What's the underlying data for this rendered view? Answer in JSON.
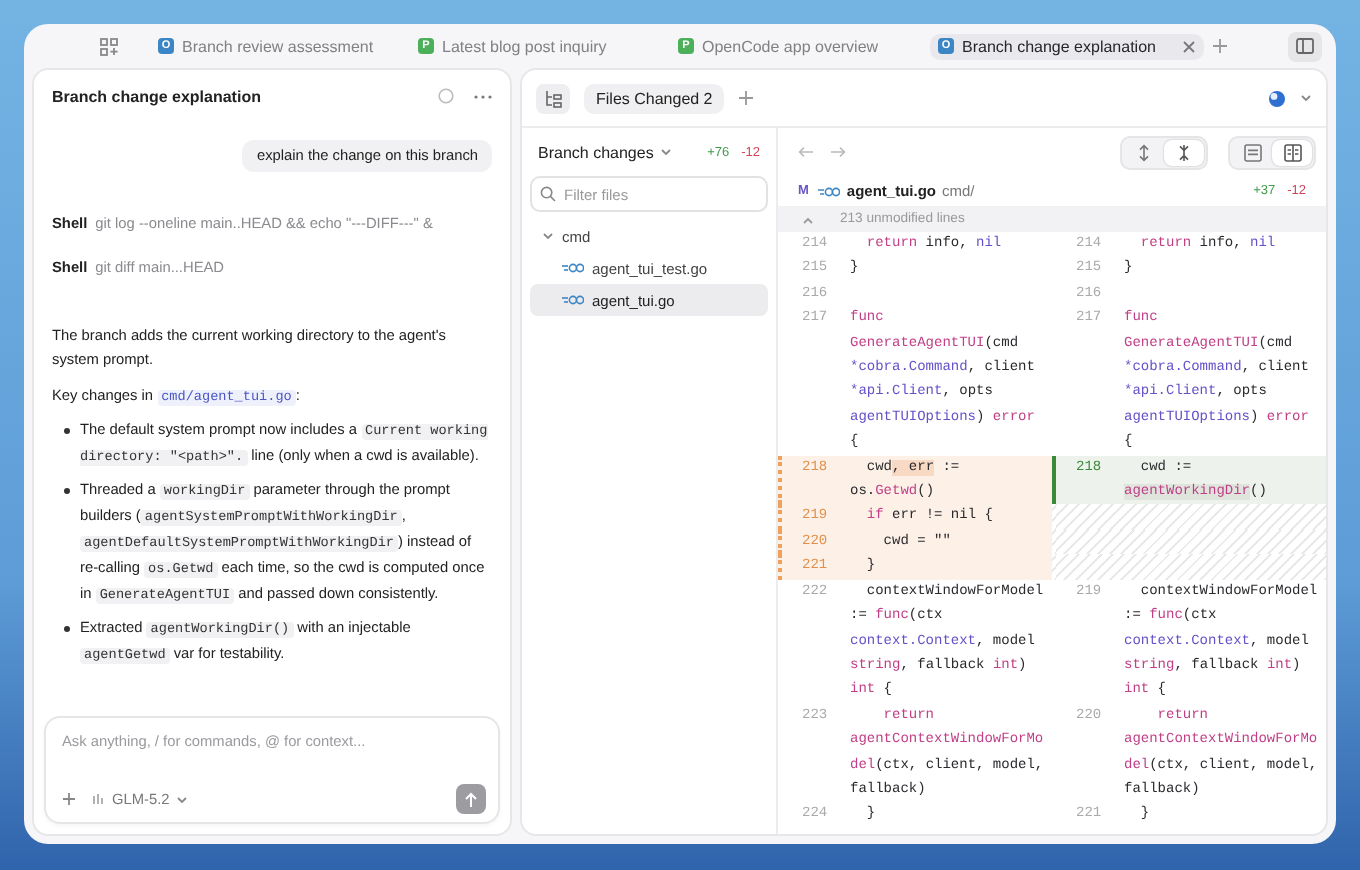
{
  "tabs": [
    {
      "badge": "O",
      "color": "#3d86c6",
      "label": "Branch review assessment",
      "selected": false
    },
    {
      "badge": "P",
      "color": "#4caf5a",
      "label": "Latest blog post inquiry",
      "selected": false
    },
    {
      "badge": "P",
      "color": "#4caf5a",
      "label": "OpenCode app overview",
      "selected": false
    },
    {
      "badge": "O",
      "color": "#3d86c6",
      "label": "Branch change explanation",
      "selected": true
    }
  ],
  "chat": {
    "title": "Branch change explanation",
    "messages": [
      {
        "kind": "user",
        "text": "explain the change on this branch"
      },
      {
        "kind": "shell",
        "label": "Shell",
        "command": "git log --oneline main..HEAD && echo \"---DIFF---\" &"
      },
      {
        "kind": "shell",
        "label": "Shell",
        "command": "git diff main...HEAD"
      },
      {
        "kind": "paragraph",
        "parts": [
          {
            "kind": "text",
            "text": "The branch adds the current working directory to the agent's system prompt."
          }
        ]
      },
      {
        "kind": "paragraph",
        "parts": [
          {
            "kind": "text",
            "text": "Key changes in "
          },
          {
            "kind": "link",
            "text": "cmd/agent_tui.go"
          },
          {
            "kind": "text",
            "text": ":"
          }
        ]
      },
      {
        "kind": "bullets",
        "items": [
          [
            {
              "kind": "text",
              "text": "The default system prompt now includes a "
            },
            {
              "kind": "code",
              "text": "Current working directory: \"<path>\"."
            },
            {
              "kind": "text",
              "text": " line (only when a cwd is available)."
            }
          ],
          [
            {
              "kind": "text",
              "text": "Threaded a "
            },
            {
              "kind": "code",
              "text": "workingDir"
            },
            {
              "kind": "text",
              "text": " parameter through the prompt builders ("
            },
            {
              "kind": "code",
              "text": "agentSystemPromptWithWorkingDir"
            },
            {
              "kind": "text",
              "text": ", "
            },
            {
              "kind": "code",
              "text": "agentDefaultSystemPromptWithWorkingDir"
            },
            {
              "kind": "text",
              "text": ") instead of re-calling "
            },
            {
              "kind": "code",
              "text": "os.Getwd"
            },
            {
              "kind": "text",
              "text": " each time, so the cwd is computed once in "
            },
            {
              "kind": "code",
              "text": "GenerateAgentTUI"
            },
            {
              "kind": "text",
              "text": " and passed down consistently."
            }
          ],
          [
            {
              "kind": "text",
              "text": "Extracted "
            },
            {
              "kind": "code",
              "text": "agentWorkingDir()"
            },
            {
              "kind": "text",
              "text": " with an injectable "
            },
            {
              "kind": "code",
              "text": "agentGetwd"
            },
            {
              "kind": "text",
              "text": " var for testability."
            }
          ]
        ]
      }
    ],
    "composer": {
      "placeholder": "Ask anything, / for commands, @ for context...",
      "model": "GLM-5.2"
    }
  },
  "workspace_tabs": [
    {
      "label": "Files Changed 2",
      "selected": true
    }
  ],
  "changes": {
    "title": "Branch changes",
    "added": "+76",
    "removed": "-12",
    "filter_placeholder": "Filter files",
    "tree": [
      {
        "name": "cmd",
        "expanded": true,
        "selected": false,
        "children": [
          {
            "name": "agent_tui_test.go",
            "selected": false
          },
          {
            "name": "agent_tui.go",
            "selected": true
          }
        ]
      }
    ]
  },
  "diff": {
    "view_controls": [
      {
        "kind": "expand",
        "selected": false
      },
      {
        "kind": "collapse",
        "selected": true
      }
    ],
    "layout_controls": [
      {
        "kind": "unified",
        "selected": false
      },
      {
        "kind": "split",
        "selected": true
      }
    ],
    "file": {
      "status": "M",
      "name": "agent_tui.go",
      "dir": "cmd/",
      "added": "+37",
      "removed": "-12"
    },
    "collapsed": "213 unmodified lines",
    "rows": [
      {
        "left": {
          "kind": "context",
          "num": "214",
          "lines": [
            [
              {
                "kind": "kw",
                "text": "  return"
              },
              {
                "kind": "plain",
                "text": " info, "
              },
              {
                "kind": "type",
                "text": "nil"
              }
            ]
          ]
        },
        "right": {
          "kind": "context",
          "num": "214",
          "lines": [
            [
              {
                "kind": "kw",
                "text": "  return"
              },
              {
                "kind": "plain",
                "text": " info, "
              },
              {
                "kind": "type",
                "text": "nil"
              }
            ]
          ]
        }
      },
      {
        "left": {
          "kind": "context",
          "num": "215",
          "lines": [
            [
              {
                "kind": "plain",
                "text": "}"
              }
            ]
          ]
        },
        "right": {
          "kind": "context",
          "num": "215",
          "lines": [
            [
              {
                "kind": "plain",
                "text": "}"
              }
            ]
          ]
        }
      },
      {
        "left": {
          "kind": "context",
          "num": "216"
        },
        "right": {
          "kind": "context",
          "num": "216"
        }
      },
      {
        "left": {
          "kind": "context",
          "num": "217",
          "lines": [
            [
              {
                "kind": "kw",
                "text": "func"
              }
            ],
            [
              {
                "kind": "fn",
                "text": "GenerateAgentTUI"
              },
              {
                "kind": "plain",
                "text": "(cmd"
              }
            ],
            [
              {
                "kind": "type",
                "text": "*cobra.Command"
              },
              {
                "kind": "plain",
                "text": ", client"
              }
            ],
            [
              {
                "kind": "type",
                "text": "*api.Client"
              },
              {
                "kind": "plain",
                "text": ", opts"
              }
            ],
            [
              {
                "kind": "type",
                "text": "agentTUIOptions"
              },
              {
                "kind": "plain",
                "text": ") "
              },
              {
                "kind": "kw",
                "text": "error"
              }
            ],
            [
              {
                "kind": "plain",
                "text": "{"
              }
            ]
          ]
        },
        "right": {
          "kind": "context",
          "num": "217",
          "lines": [
            [
              {
                "kind": "kw",
                "text": "func"
              }
            ],
            [
              {
                "kind": "fn",
                "text": "GenerateAgentTUI"
              },
              {
                "kind": "plain",
                "text": "(cmd"
              }
            ],
            [
              {
                "kind": "type",
                "text": "*cobra.Command"
              },
              {
                "kind": "plain",
                "text": ", client"
              }
            ],
            [
              {
                "kind": "type",
                "text": "*api.Client"
              },
              {
                "kind": "plain",
                "text": ", opts"
              }
            ],
            [
              {
                "kind": "type",
                "text": "agentTUIOptions"
              },
              {
                "kind": "plain",
                "text": ") "
              },
              {
                "kind": "kw",
                "text": "error"
              }
            ],
            [
              {
                "kind": "plain",
                "text": "{"
              }
            ]
          ]
        }
      },
      {
        "left": {
          "kind": "deleted",
          "num": "218",
          "lines": [
            [
              {
                "kind": "plain",
                "text": "  cwd"
              },
              {
                "kind": "changed",
                "text": ", err"
              },
              {
                "kind": "plain",
                "text": " :="
              }
            ],
            [
              {
                "kind": "plain",
                "text": "os."
              },
              {
                "kind": "fn",
                "text": "Getwd"
              },
              {
                "kind": "plain",
                "text": "()"
              }
            ]
          ]
        },
        "right": {
          "kind": "added",
          "num": "218",
          "lines": [
            [
              {
                "kind": "plain",
                "text": "  cwd :="
              }
            ],
            [
              {
                "kind": "fn-changed",
                "text": "agentWorkingDir"
              },
              {
                "kind": "plain",
                "text": "()"
              }
            ]
          ]
        }
      },
      {
        "left": {
          "kind": "deleted",
          "num": "219",
          "lines": [
            [
              {
                "kind": "kw",
                "text": "  if"
              },
              {
                "kind": "plain",
                "text": " err != nil {"
              }
            ]
          ]
        },
        "right": {
          "kind": "empty"
        }
      },
      {
        "left": {
          "kind": "deleted",
          "num": "220",
          "lines": [
            [
              {
                "kind": "plain",
                "text": "    cwd = \"\""
              }
            ]
          ]
        },
        "right": {
          "kind": "empty"
        }
      },
      {
        "left": {
          "kind": "deleted",
          "num": "221",
          "lines": [
            [
              {
                "kind": "plain",
                "text": "  }"
              }
            ]
          ]
        },
        "right": {
          "kind": "empty"
        }
      },
      {
        "left": {
          "kind": "context",
          "num": "222",
          "lines": [
            [
              {
                "kind": "plain",
                "text": "  contextWindowForModel"
              }
            ],
            [
              {
                "kind": "plain",
                "text": ":= "
              },
              {
                "kind": "kw",
                "text": "func"
              },
              {
                "kind": "plain",
                "text": "(ctx"
              }
            ],
            [
              {
                "kind": "type",
                "text": "context.Context"
              },
              {
                "kind": "plain",
                "text": ", model"
              }
            ],
            [
              {
                "kind": "kw",
                "text": "string"
              },
              {
                "kind": "plain",
                "text": ", fallback "
              },
              {
                "kind": "kw",
                "text": "int"
              },
              {
                "kind": "plain",
                "text": ")"
              }
            ],
            [
              {
                "kind": "kw",
                "text": "int"
              },
              {
                "kind": "plain",
                "text": " {"
              }
            ]
          ]
        },
        "right": {
          "kind": "context",
          "num": "219",
          "lines": [
            [
              {
                "kind": "plain",
                "text": "  contextWindowForModel"
              }
            ],
            [
              {
                "kind": "plain",
                "text": ":= "
              },
              {
                "kind": "kw",
                "text": "func"
              },
              {
                "kind": "plain",
                "text": "(ctx"
              }
            ],
            [
              {
                "kind": "type",
                "text": "context.Context"
              },
              {
                "kind": "plain",
                "text": ", model"
              }
            ],
            [
              {
                "kind": "kw",
                "text": "string"
              },
              {
                "kind": "plain",
                "text": ", fallback "
              },
              {
                "kind": "kw",
                "text": "int"
              },
              {
                "kind": "plain",
                "text": ")"
              }
            ],
            [
              {
                "kind": "kw",
                "text": "int"
              },
              {
                "kind": "plain",
                "text": " {"
              }
            ]
          ]
        }
      },
      {
        "left": {
          "kind": "context",
          "num": "223",
          "lines": [
            [
              {
                "kind": "kw",
                "text": "    return"
              }
            ],
            [
              {
                "kind": "fn",
                "text": "agentContextWindowForMo"
              }
            ],
            [
              {
                "kind": "fn",
                "text": "del"
              },
              {
                "kind": "plain",
                "text": "(ctx, client, model,"
              }
            ],
            [
              {
                "kind": "plain",
                "text": "fallback)"
              }
            ]
          ]
        },
        "right": {
          "kind": "context",
          "num": "220",
          "lines": [
            [
              {
                "kind": "kw",
                "text": "    return"
              }
            ],
            [
              {
                "kind": "fn",
                "text": "agentContextWindowForMo"
              }
            ],
            [
              {
                "kind": "fn",
                "text": "del"
              },
              {
                "kind": "plain",
                "text": "(ctx, client, model,"
              }
            ],
            [
              {
                "kind": "plain",
                "text": "fallback)"
              }
            ]
          ]
        }
      },
      {
        "left": {
          "kind": "context",
          "num": "224",
          "lines": [
            [
              {
                "kind": "plain",
                "text": "  }"
              }
            ]
          ]
        },
        "right": {
          "kind": "context",
          "num": "221",
          "lines": [
            [
              {
                "kind": "plain",
                "text": "  }"
              }
            ]
          ]
        }
      }
    ]
  }
}
